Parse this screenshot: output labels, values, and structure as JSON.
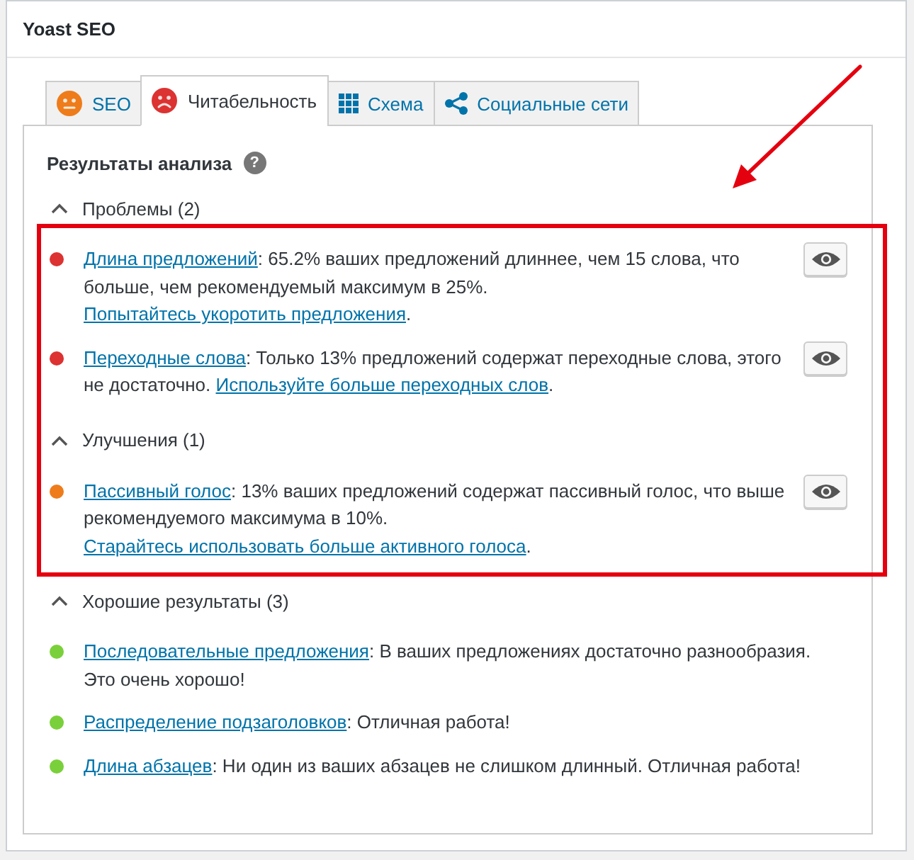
{
  "metabox": {
    "title": "Yoast SEO"
  },
  "tabs": [
    {
      "label": "SEO",
      "kind": "score",
      "color": "#ee7c1b",
      "sad": false,
      "selected": false
    },
    {
      "label": "Читабельность",
      "kind": "score",
      "color": "#dc3232",
      "sad": true,
      "selected": true
    },
    {
      "label": "Схема",
      "kind": "schema",
      "selected": false
    },
    {
      "label": "Социальные сети",
      "kind": "social",
      "selected": false
    }
  ],
  "analysis": {
    "heading": "Результаты анализа",
    "help": "?",
    "groups": [
      {
        "title": "Проблемы (2)",
        "expanded": true,
        "items": [
          {
            "color": "#dc3232",
            "label": "Длина предложений",
            "message": ": 65.2% ваших предложений длиннее, чем 15 слова, что больше, чем рекомендуемый максимум в 25%.",
            "fix": "Попытайтесь укоротить предложения",
            "end": ".",
            "highlight_button": true
          },
          {
            "color": "#dc3232",
            "label": "Переходные слова",
            "message": ": Только 13% предложений содержат переходные слова, этого не достаточно.",
            "fix": "Используйте больше переходных слов",
            "end": ".",
            "highlight_button": true
          }
        ]
      },
      {
        "title": "Улучшения (1)",
        "expanded": true,
        "items": [
          {
            "color": "#ee7c1b",
            "label": "Пассивный голос",
            "message": ": 13% ваших предложений содержат пассивный голос, что выше рекомендуемого максимума в 10%.",
            "fix": "Старайтесь использовать больше активного голоса",
            "end": ".",
            "highlight_button": true
          }
        ]
      },
      {
        "title": "Хорошие результаты (3)",
        "expanded": true,
        "items": [
          {
            "color": "#7ad03a",
            "label": "Последовательные предложения",
            "message": ": В ваших предложениях достаточно разнообразия. Это очень хорошо!",
            "highlight_button": false
          },
          {
            "color": "#7ad03a",
            "label": "Распределение подзаголовков",
            "message": ": Отличная работа!",
            "highlight_button": false
          },
          {
            "color": "#7ad03a",
            "label": "Длина абзацев",
            "message": ": Ни один из ваших абзацев не слишком длинный. Отличная работа!",
            "highlight_button": false
          }
        ]
      }
    ]
  }
}
